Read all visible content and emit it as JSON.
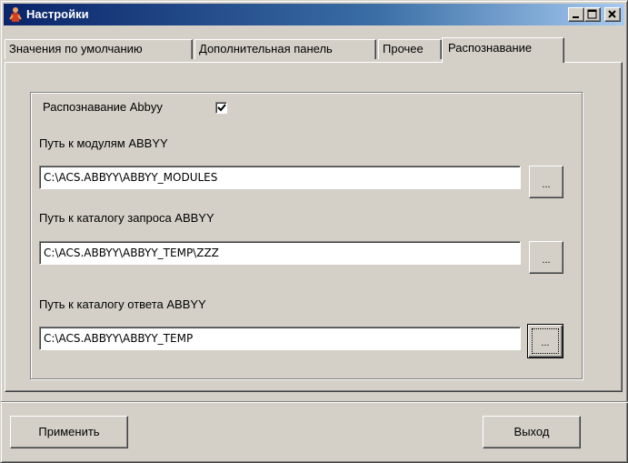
{
  "window": {
    "title": "Настройки",
    "controls": {
      "minimize": "minimize",
      "maximize": "maximize",
      "close": "close"
    }
  },
  "tabs": [
    {
      "label": "Значения по умолчанию",
      "active": false
    },
    {
      "label": "Дополнительная панель",
      "active": false
    },
    {
      "label": "Прочее",
      "active": false
    },
    {
      "label": "Распознавание",
      "active": true
    }
  ],
  "recognition": {
    "enable_label": "Распознавание Abbyy",
    "enabled": true,
    "modules_label": "Путь к модулям ABBYY",
    "modules_value": "C:\\ACS.ABBYY\\ABBYY_MODULES",
    "request_label": "Путь к каталогу запроса ABBYY",
    "request_value": "C:\\ACS.ABBYY\\ABBYY_TEMP\\ZZZ",
    "response_label": "Путь к каталогу ответа ABBYY",
    "response_value": "C:\\ACS.ABBYY\\ABBYY_TEMP",
    "browse_label": "..."
  },
  "footer": {
    "apply_label": "Применить",
    "exit_label": "Выход"
  },
  "colors": {
    "face": "#d4d0c8",
    "title_start": "#0a246a",
    "title_end": "#a6caf0",
    "shadow": "#808080"
  },
  "icons": {
    "app": "app-figure-icon",
    "minimize": "minimize-icon",
    "maximize": "maximize-icon",
    "close": "close-icon",
    "check": "checkmark-icon"
  }
}
